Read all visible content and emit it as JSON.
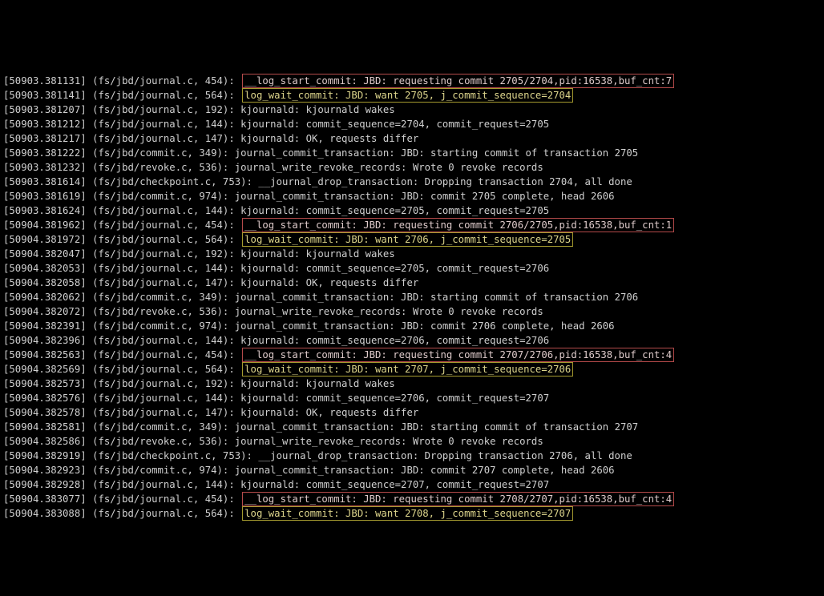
{
  "lines": [
    {
      "ts": "[50903.381131]",
      "src": "(fs/jbd/journal.c, 454):",
      "hl": "red",
      "msg": "__log_start_commit: JBD: requesting commit 2705/2704,pid:16538,buf_cnt:7"
    },
    {
      "ts": "[50903.381141]",
      "src": "(fs/jbd/journal.c, 564):",
      "hl": "yel",
      "msg": "log_wait_commit: JBD: want 2705, j_commit_sequence=2704"
    },
    {
      "ts": "[50903.381207]",
      "src": "(fs/jbd/journal.c, 192):",
      "msg": "kjournald: kjournald wakes"
    },
    {
      "ts": "[50903.381212]",
      "src": "(fs/jbd/journal.c, 144):",
      "msg": "kjournald: commit_sequence=2704, commit_request=2705"
    },
    {
      "ts": "[50903.381217]",
      "src": "(fs/jbd/journal.c, 147):",
      "msg": "kjournald: OK, requests differ"
    },
    {
      "ts": "[50903.381222]",
      "src": "(fs/jbd/commit.c, 349):",
      "msg": "journal_commit_transaction: JBD: starting commit of transaction 2705"
    },
    {
      "ts": "[50903.381232]",
      "src": "(fs/jbd/revoke.c, 536):",
      "msg": "journal_write_revoke_records: Wrote 0 revoke records"
    },
    {
      "ts": "[50903.381614]",
      "src": "(fs/jbd/checkpoint.c, 753):",
      "msg": "__journal_drop_transaction: Dropping transaction 2704, all done"
    },
    {
      "ts": "[50903.381619]",
      "src": "(fs/jbd/commit.c, 974):",
      "msg": "journal_commit_transaction: JBD: commit 2705 complete, head 2606"
    },
    {
      "ts": "[50903.381624]",
      "src": "(fs/jbd/journal.c, 144):",
      "msg": "kjournald: commit_sequence=2705, commit_request=2705"
    },
    {
      "ts": "[50904.381962]",
      "src": "(fs/jbd/journal.c, 454):",
      "hl": "red",
      "msg": "__log_start_commit: JBD: requesting commit 2706/2705,pid:16538,buf_cnt:1"
    },
    {
      "ts": "[50904.381972]",
      "src": "(fs/jbd/journal.c, 564):",
      "hl": "yel",
      "msg": "log_wait_commit: JBD: want 2706, j_commit_sequence=2705"
    },
    {
      "ts": "[50904.382047]",
      "src": "(fs/jbd/journal.c, 192):",
      "msg": "kjournald: kjournald wakes"
    },
    {
      "ts": "[50904.382053]",
      "src": "(fs/jbd/journal.c, 144):",
      "msg": "kjournald: commit_sequence=2705, commit_request=2706"
    },
    {
      "ts": "[50904.382058]",
      "src": "(fs/jbd/journal.c, 147):",
      "msg": "kjournald: OK, requests differ"
    },
    {
      "ts": "[50904.382062]",
      "src": "(fs/jbd/commit.c, 349):",
      "msg": "journal_commit_transaction: JBD: starting commit of transaction 2706"
    },
    {
      "ts": "[50904.382072]",
      "src": "(fs/jbd/revoke.c, 536):",
      "msg": "journal_write_revoke_records: Wrote 0 revoke records"
    },
    {
      "ts": "[50904.382391]",
      "src": "(fs/jbd/commit.c, 974):",
      "msg": "journal_commit_transaction: JBD: commit 2706 complete, head 2606"
    },
    {
      "ts": "[50904.382396]",
      "src": "(fs/jbd/journal.c, 144):",
      "msg": "kjournald: commit_sequence=2706, commit_request=2706"
    },
    {
      "ts": "[50904.382563]",
      "src": "(fs/jbd/journal.c, 454):",
      "hl": "red",
      "msg": "__log_start_commit: JBD: requesting commit 2707/2706,pid:16538,buf_cnt:4"
    },
    {
      "ts": "[50904.382569]",
      "src": "(fs/jbd/journal.c, 564):",
      "hl": "yel",
      "msg": "log_wait_commit: JBD: want 2707, j_commit_sequence=2706"
    },
    {
      "ts": "[50904.382573]",
      "src": "(fs/jbd/journal.c, 192):",
      "msg": "kjournald: kjournald wakes"
    },
    {
      "ts": "[50904.382576]",
      "src": "(fs/jbd/journal.c, 144):",
      "msg": "kjournald: commit_sequence=2706, commit_request=2707"
    },
    {
      "ts": "[50904.382578]",
      "src": "(fs/jbd/journal.c, 147):",
      "msg": "kjournald: OK, requests differ"
    },
    {
      "ts": "[50904.382581]",
      "src": "(fs/jbd/commit.c, 349):",
      "msg": "journal_commit_transaction: JBD: starting commit of transaction 2707"
    },
    {
      "ts": "[50904.382586]",
      "src": "(fs/jbd/revoke.c, 536):",
      "msg": "journal_write_revoke_records: Wrote 0 revoke records"
    },
    {
      "ts": "[50904.382919]",
      "src": "(fs/jbd/checkpoint.c, 753):",
      "msg": "__journal_drop_transaction: Dropping transaction 2706, all done"
    },
    {
      "ts": "[50904.382923]",
      "src": "(fs/jbd/commit.c, 974):",
      "msg": "journal_commit_transaction: JBD: commit 2707 complete, head 2606"
    },
    {
      "ts": "[50904.382928]",
      "src": "(fs/jbd/journal.c, 144):",
      "msg": "kjournald: commit_sequence=2707, commit_request=2707"
    },
    {
      "ts": "[50904.383077]",
      "src": "(fs/jbd/journal.c, 454):",
      "hl": "red",
      "msg": "__log_start_commit: JBD: requesting commit 2708/2707,pid:16538,buf_cnt:4"
    },
    {
      "ts": "[50904.383088]",
      "src": "(fs/jbd/journal.c, 564):",
      "hl": "yel",
      "msg": "log_wait_commit: JBD: want 2708, j_commit_sequence=2707"
    }
  ]
}
